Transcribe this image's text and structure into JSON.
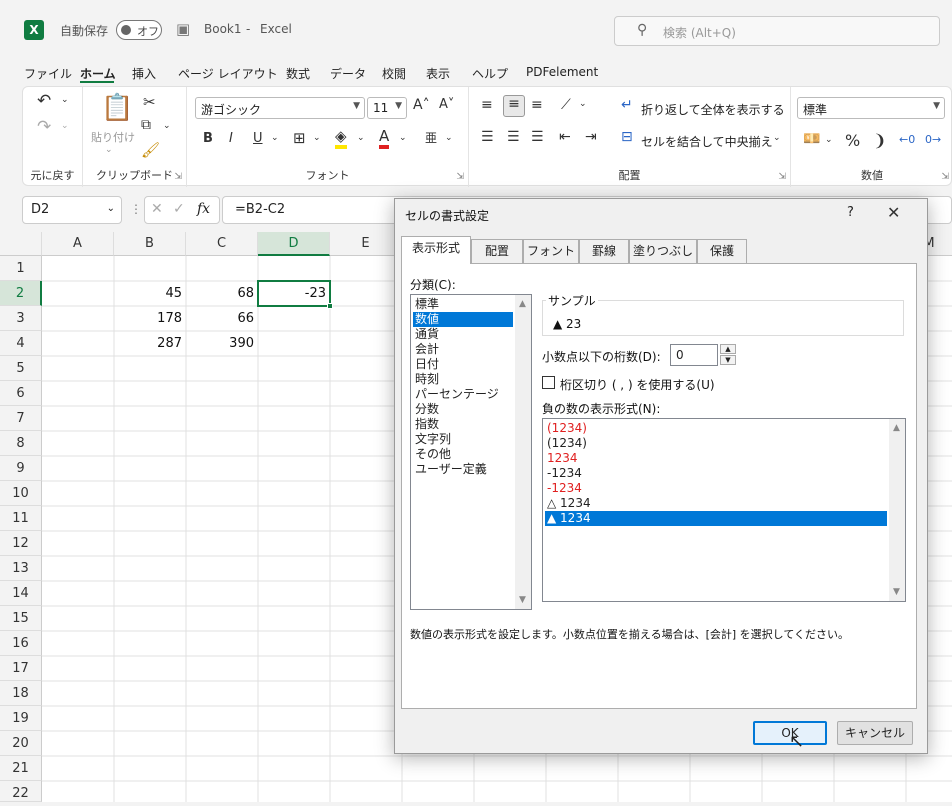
{
  "titlebar": {
    "logo": "X",
    "autosave_label": "自動保存",
    "autosave_state": "オフ",
    "doc_title": "Book1",
    "separator": "-",
    "app_name": "Excel",
    "search_placeholder": "検索 (Alt+Q)"
  },
  "menu": [
    {
      "label": "ファイル",
      "active": false
    },
    {
      "label": "ホーム",
      "active": true
    },
    {
      "label": "挿入",
      "active": false
    },
    {
      "label": "ページ レイアウト",
      "active": false
    },
    {
      "label": "数式",
      "active": false
    },
    {
      "label": "データ",
      "active": false
    },
    {
      "label": "校閲",
      "active": false
    },
    {
      "label": "表示",
      "active": false
    },
    {
      "label": "ヘルプ",
      "active": false
    },
    {
      "label": "PDFelement",
      "active": false
    }
  ],
  "ribbon": {
    "undo_group": "元に戻す",
    "clipboard_group": "クリップボード",
    "paste_label": "貼り付け",
    "font_group": "フォント",
    "font_name": "游ゴシック",
    "font_size": "11",
    "bold": "B",
    "italic": "I",
    "underline": "U",
    "align_group": "配置",
    "wrap_text": "折り返して全体を表示する",
    "merge_center": "セルを結合して中央揃え",
    "number_group": "数値",
    "number_format": "標準",
    "percent": "%",
    "comma": "❩"
  },
  "formula_bar": {
    "name_box": "D2",
    "fx": "fx",
    "formula": "=B2-C2"
  },
  "sheet": {
    "columns": [
      "A",
      "B",
      "C",
      "D",
      "E",
      "M"
    ],
    "selected_column": "D",
    "rows": [
      "1",
      "2",
      "3",
      "4",
      "5",
      "6",
      "7",
      "8",
      "9",
      "10",
      "11",
      "12",
      "13",
      "14",
      "15",
      "16",
      "17",
      "18",
      "19",
      "20",
      "21",
      "22"
    ],
    "selected_row": "2",
    "cells": {
      "B2": "45",
      "C2": "68",
      "D2": "-23",
      "B3": "178",
      "C3": "66",
      "B4": "287",
      "C4": "390"
    }
  },
  "dialog": {
    "title": "セルの書式設定",
    "help": "?",
    "close": "✕",
    "tabs": [
      {
        "label": "表示形式",
        "active": true
      },
      {
        "label": "配置",
        "active": false
      },
      {
        "label": "フォント",
        "active": false
      },
      {
        "label": "罫線",
        "active": false
      },
      {
        "label": "塗りつぶし",
        "active": false
      },
      {
        "label": "保護",
        "active": false
      }
    ],
    "category_label": "分類(C):",
    "categories": [
      {
        "label": "標準",
        "selected": false
      },
      {
        "label": "数値",
        "selected": true
      },
      {
        "label": "通貨",
        "selected": false
      },
      {
        "label": "会計",
        "selected": false
      },
      {
        "label": "日付",
        "selected": false
      },
      {
        "label": "時刻",
        "selected": false
      },
      {
        "label": "パーセンテージ",
        "selected": false
      },
      {
        "label": "分数",
        "selected": false
      },
      {
        "label": "指数",
        "selected": false
      },
      {
        "label": "文字列",
        "selected": false
      },
      {
        "label": "その他",
        "selected": false
      },
      {
        "label": "ユーザー定義",
        "selected": false
      }
    ],
    "sample_label": "サンプル",
    "sample_value": "▲ 23",
    "decimal_label": "小数点以下の桁数(D):",
    "decimal_value": "0",
    "separator_label": "桁区切り ( , ) を使用する(U)",
    "negative_label": "負の数の表示形式(N):",
    "negative_formats": [
      {
        "label": "(1234)",
        "red": true,
        "selected": false
      },
      {
        "label": "(1234)",
        "red": false,
        "selected": false
      },
      {
        "label": "1234",
        "red": true,
        "selected": false
      },
      {
        "label": "-1234",
        "red": false,
        "selected": false
      },
      {
        "label": "-1234",
        "red": true,
        "selected": false
      },
      {
        "label": "△ 1234",
        "red": false,
        "selected": false
      },
      {
        "label": "▲ 1234",
        "red": false,
        "selected": true
      }
    ],
    "description": "数値の表示形式を設定します。小数点位置を揃える場合は、[会計] を選択してください。",
    "ok": "OK",
    "cancel": "キャンセル"
  },
  "colors": {
    "excel_green": "#107c41",
    "selection_blue": "#0078d7",
    "negative_red": "#e02020"
  }
}
